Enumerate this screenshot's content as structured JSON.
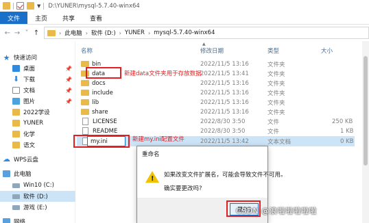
{
  "window": {
    "title": "D:\\YUNER\\mysql-5.7.40-winx64"
  },
  "ribbon": {
    "tabs": [
      "文件",
      "主页",
      "共享",
      "查看"
    ]
  },
  "address": {
    "crumbs": [
      "此电脑",
      "软件 (D:)",
      "YUNER",
      "mysql-5.7.40-winx64"
    ]
  },
  "nav": {
    "items": [
      {
        "label": "快速访问",
        "icon": "star-icon"
      },
      {
        "label": "桌面",
        "icon": "desktop-icon"
      },
      {
        "label": "下载",
        "icon": "download-icon"
      },
      {
        "label": "文档",
        "icon": "document-icon"
      },
      {
        "label": "图片",
        "icon": "picture-icon"
      },
      {
        "label": "2022学设",
        "icon": "folder-icon"
      },
      {
        "label": "YUNER",
        "icon": "folder-icon"
      },
      {
        "label": "化学",
        "icon": "folder-icon"
      },
      {
        "label": "语文",
        "icon": "folder-icon"
      },
      {
        "label": "WPS云盘",
        "icon": "cloud-icon"
      },
      {
        "label": "此电脑",
        "icon": "pc-icon"
      },
      {
        "label": "Win10 (C:)",
        "icon": "drive-icon"
      },
      {
        "label": "软件 (D:)",
        "icon": "drive-icon"
      },
      {
        "label": "游戏 (E:)",
        "icon": "drive-icon"
      },
      {
        "label": "网络",
        "icon": "network-icon"
      }
    ]
  },
  "columns": {
    "name": "名称",
    "modified": "修改日期",
    "type": "类型",
    "size": "大小"
  },
  "files": [
    {
      "name": "bin",
      "modified": "2022/11/5 13:16",
      "type": "文件夹",
      "size": "",
      "kind": "folder"
    },
    {
      "name": "data",
      "modified": "2022/11/5 13:41",
      "type": "文件夹",
      "size": "",
      "kind": "folder"
    },
    {
      "name": "docs",
      "modified": "2022/11/5 13:16",
      "type": "文件夹",
      "size": "",
      "kind": "folder"
    },
    {
      "name": "include",
      "modified": "2022/11/5 13:16",
      "type": "文件夹",
      "size": "",
      "kind": "folder"
    },
    {
      "name": "lib",
      "modified": "2022/11/5 13:16",
      "type": "文件夹",
      "size": "",
      "kind": "folder"
    },
    {
      "name": "share",
      "modified": "2022/11/5 13:16",
      "type": "文件夹",
      "size": "",
      "kind": "folder"
    },
    {
      "name": "LICENSE",
      "modified": "2022/8/30 3:50",
      "type": "文件",
      "size": "250 KB",
      "kind": "file"
    },
    {
      "name": "README",
      "modified": "2022/8/30 3:50",
      "type": "文件",
      "size": "1 KB",
      "kind": "file"
    },
    {
      "name": "my.ini",
      "modified": "2022/11/5 13:42",
      "type": "文本文档",
      "size": "0 KB",
      "kind": "file"
    }
  ],
  "annotations": {
    "data_note": "新建data文件夹用于存放数据",
    "ini_note": "新建my.ini配置文件"
  },
  "dialog": {
    "title": "重命名",
    "message": "如果改变文件扩展名，可能会导致文件不可用。",
    "question": "确实要更改吗?",
    "yes": "是(Y)"
  },
  "watermark": "CSDN @浪啦啦啦啦啦",
  "colors": {
    "accent": "#1a6fc9",
    "selection": "#cce4f7",
    "annotation": "#e02020",
    "folder": "#e9b949"
  }
}
